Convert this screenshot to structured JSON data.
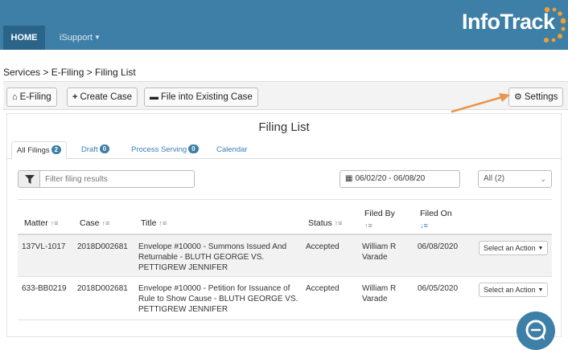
{
  "nav": {
    "home": "HOME",
    "isupport": "iSupport",
    "logo": "InfoTrack"
  },
  "breadcrumb": "Services > E-Filing > Filing List",
  "toolbar": {
    "efiling": "E-Filing",
    "create_case": "Create Case",
    "file_existing": "File into Existing Case",
    "settings": "Settings"
  },
  "panel": {
    "title": "Filing List",
    "tabs": [
      {
        "label": "All Filings",
        "count": "2"
      },
      {
        "label": "Draft",
        "count": "0"
      },
      {
        "label": "Process Serving",
        "count": "0"
      },
      {
        "label": "Calendar"
      }
    ],
    "filter": {
      "placeholder": "Filter filing results",
      "date_range": "06/02/20 - 06/08/20",
      "status_select": "All (2)"
    },
    "columns": {
      "matter": "Matter",
      "case": "Case",
      "title": "Title",
      "status": "Status",
      "filed_by_1": "Filed By",
      "filed_on": "Filed On"
    },
    "rows": [
      {
        "matter": "137VL-1017",
        "case": "2018D002681",
        "title_l1": "Envelope #10000 - Summons Issued And",
        "title_l2": "Returnable - BLUTH GEORGE VS.",
        "title_l3": "PETTIGREW JENNIFER",
        "status": "Accepted",
        "filed_by_l1": "William R",
        "filed_by_l2": "Varade",
        "filed_on": "06/08/2020",
        "action": "Select an Action"
      },
      {
        "matter": "633-BB0219",
        "case": "2018D002681",
        "title_l1": "Envelope #10000 - Petition for Issuance of",
        "title_l2": "Rule to Show Cause - BLUTH GEORGE VS.",
        "title_l3": "PETTIGREW JENNIFER",
        "status": "Accepted",
        "filed_by_l1": "William R",
        "filed_by_l2": "Varade",
        "filed_on": "06/05/2020",
        "action": "Select an Action"
      }
    ]
  },
  "colors": {
    "brand": "#3d7fa6",
    "nav_active": "#2a6488",
    "logo_dots": "#f0a030",
    "link": "#3b7fb3",
    "arrow": "#e8944a"
  },
  "icons": {
    "efiling": "home-icon",
    "create_case": "plus-icon",
    "file_existing": "inbox-icon",
    "settings": "gear-icon",
    "filter": "funnel-icon",
    "date": "calendar-icon",
    "chat": "chat-icon"
  }
}
